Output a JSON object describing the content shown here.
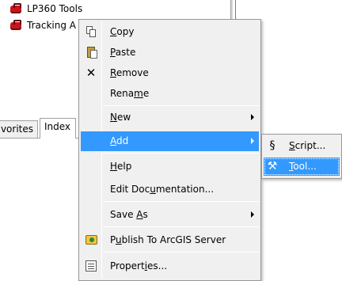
{
  "tree": {
    "items": [
      {
        "label": "LP360 Tools",
        "icon": "toolbox-icon"
      },
      {
        "label": "Tracking A",
        "icon": "toolbox-icon"
      }
    ]
  },
  "tabs": {
    "favorites": "vorites",
    "index": "Index"
  },
  "menu": {
    "items": [
      {
        "label": "Copy",
        "accel": "C",
        "icon": "copy-icon"
      },
      {
        "label": "Paste",
        "accel": "P",
        "icon": "paste-icon"
      },
      {
        "label": "Remove",
        "accel": "R",
        "icon": "remove-x-icon"
      },
      {
        "label": "Rename",
        "accel": "m"
      },
      {
        "label": "New",
        "accel": "N",
        "submenu": true
      },
      {
        "label": "Add",
        "accel": "A",
        "submenu": true,
        "highlighted": true
      },
      {
        "label": "Help",
        "accel": "H"
      },
      {
        "label": "Edit Documentation...",
        "accel": "u"
      },
      {
        "label": "Save As",
        "accel": "A",
        "submenu": true
      },
      {
        "label": "Publish To ArcGIS Server",
        "accel": "u",
        "icon": "publish-icon"
      },
      {
        "label": "Properties...",
        "accel": "i",
        "icon": "properties-icon"
      }
    ]
  },
  "submenu": {
    "items": [
      {
        "label": "Script...",
        "accel": "S",
        "icon": "script-icon"
      },
      {
        "label": "Tool...",
        "accel": "T",
        "icon": "tool-hammer-icon",
        "highlighted": true
      }
    ]
  },
  "colors": {
    "highlight": "#3399ff",
    "menu_bg": "#f0f0f0",
    "toolbox_red": "#c8141e"
  }
}
